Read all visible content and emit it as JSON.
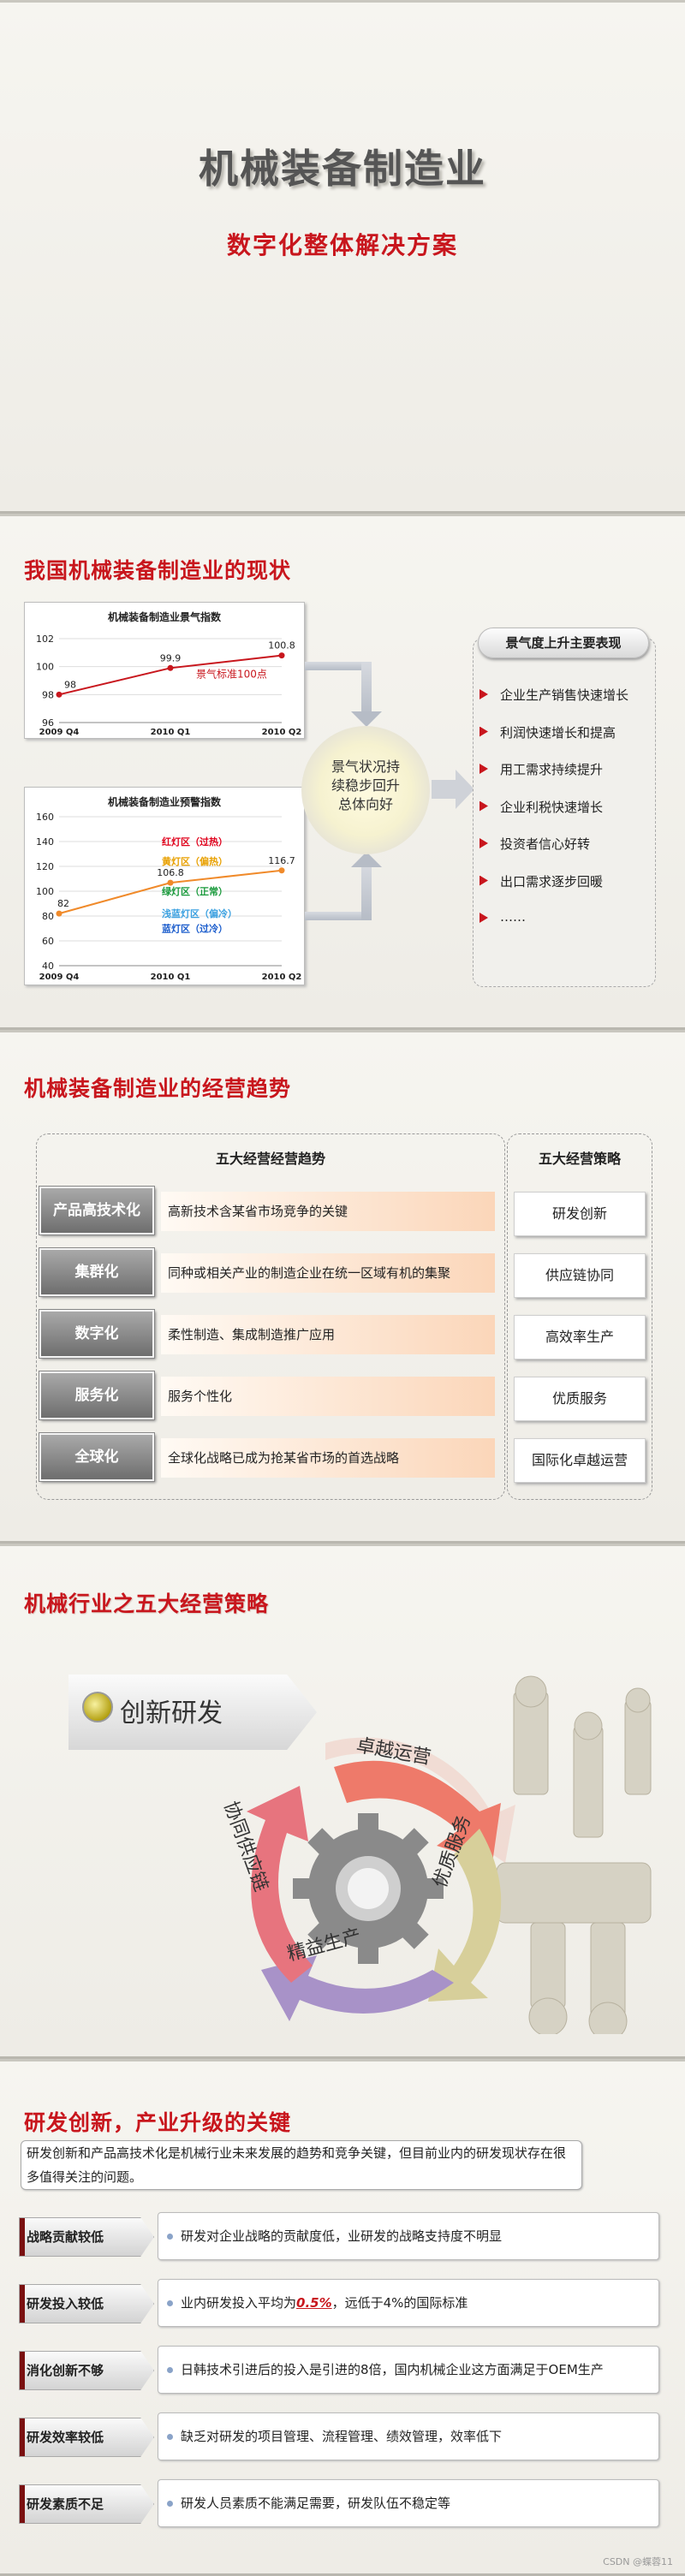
{
  "slide1": {
    "title": "机械装备制造业",
    "subtitle": "数字化整体解决方案"
  },
  "slide2": {
    "title": "我国机械装备制造业的现状",
    "center_text": "景气状况持续稳步回升总体向好",
    "panel_title": "景气度上升主要表现",
    "items": [
      "企业生产销售快速增长",
      "利润快速增长和提高",
      "用工需求持续提升",
      "企业利税快速增长",
      "投资者信心好转",
      "出口需求逐步回暖",
      "……"
    ],
    "chart1": {
      "title": "机械装备制造业景气指数",
      "x": [
        "2009 Q4",
        "2010 Q1",
        "2010 Q2"
      ],
      "values": [
        98,
        99.9,
        100.8
      ],
      "value_labels": [
        "98",
        "99.9",
        "100.8"
      ],
      "yticks": [
        "102",
        "100",
        "98",
        "96"
      ],
      "yrange": [
        96,
        102
      ],
      "annotation": "景气标准100点",
      "color": "#c8161d"
    },
    "chart2": {
      "title": "机械装备制造业预警指数",
      "x": [
        "2009 Q4",
        "2010 Q1",
        "2010 Q2"
      ],
      "values": [
        82,
        106.8,
        116.7
      ],
      "value_labels": [
        "82",
        "106.8",
        "116.7"
      ],
      "yticks": [
        "160",
        "140",
        "120",
        "100",
        "80",
        "60",
        "40"
      ],
      "yrange": [
        40,
        160
      ],
      "zones": [
        {
          "label": "红灯区（过热）",
          "color": "#e0001b"
        },
        {
          "label": "黄灯区（偏热）",
          "color": "#e8a000"
        },
        {
          "label": "绿灯区（正常）",
          "color": "#1a9a3c"
        },
        {
          "label": "浅蓝灯区（偏冷）",
          "color": "#3aa0e0"
        },
        {
          "label": "蓝灯区（过冷）",
          "color": "#1a5ccc"
        }
      ],
      "color": "#f08a2a"
    }
  },
  "slide3": {
    "title": "机械装备制造业的经营趋势",
    "trends_heading": "五大经营经营趋势",
    "strategies_heading": "五大经营策略",
    "trends": [
      {
        "label": "产品高技术化",
        "desc": "高新技术含某省市场竞争的关键"
      },
      {
        "label": "集群化",
        "desc": "同种或相关产业的制造企业在统一区域有机的集聚"
      },
      {
        "label": "数字化",
        "desc": "柔性制造、集成制造推广应用"
      },
      {
        "label": "服务化",
        "desc": "服务个性化"
      },
      {
        "label": "全球化",
        "desc": "全球化战略已成为抢某省市场的首选战略"
      }
    ],
    "strategies": [
      "研发创新",
      "供应链协同",
      "高效率生产",
      "优质服务",
      "国际化卓越运营"
    ]
  },
  "slide4": {
    "title": "机械行业之五大经营策略",
    "innovation": "创新研发",
    "cycle": [
      "卓越运营",
      "优质服务",
      "精益生产",
      "协同供应链"
    ]
  },
  "slide5": {
    "title": "研发创新，产业升级的关键",
    "intro": "研发创新和产品高技术化是机械行业未来发展的趋势和竞争关键，但目前业内的研发现状存在很多值得关注的问题。",
    "rows": [
      {
        "tag": "战略贡献较低",
        "pre": "研发对企业战略的贡献度低，业研发的战略支持度不明显",
        "em": "",
        "post": ""
      },
      {
        "tag": "研发投入较低",
        "pre": "业内研发投入平均为",
        "em": "0.5%",
        "post": "，远低于4%的国际标准"
      },
      {
        "tag": "消化创新不够",
        "pre": "日韩技术引进后的投入是引进的8倍，国内机械企业这方面满足于OEM生产",
        "em": "",
        "post": ""
      },
      {
        "tag": "研发效率较低",
        "pre": "缺乏对研发的项目管理、流程管理、绩效管理，效率低下",
        "em": "",
        "post": ""
      },
      {
        "tag": "研发素质不足",
        "pre": "研发人员素质不能满足需要，研发队伍不稳定等",
        "em": "",
        "post": ""
      }
    ],
    "watermark": "CSDN @蝶蓉11"
  }
}
